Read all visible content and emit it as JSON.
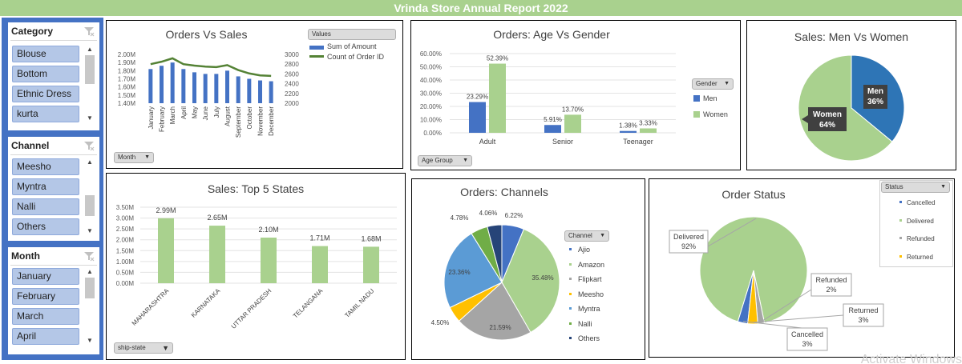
{
  "report_title": "Vrinda Store Annual Report 2022",
  "watermark": "Activate Windows",
  "colors": {
    "green": "#a9d18e",
    "blue": "#4472c4",
    "slicer_item": "#b4c7e7"
  },
  "slicers": {
    "category": {
      "title": "Category",
      "items": [
        "Blouse",
        "Bottom",
        "Ethnic Dress",
        "kurta"
      ]
    },
    "channel": {
      "title": "Channel",
      "items": [
        "Meesho",
        "Myntra",
        "Nalli",
        "Others"
      ]
    },
    "month": {
      "title": "Month",
      "items": [
        "January",
        "February",
        "March",
        "April"
      ]
    }
  },
  "orders_vs_sales": {
    "field_button": "Month",
    "legend_button": "Values",
    "legend": [
      "Sum of Amount",
      "Count of Order ID"
    ],
    "y_left_ticks": [
      "2.00M",
      "1.90M",
      "1.80M",
      "1.70M",
      "1.60M",
      "1.50M",
      "1.40M"
    ],
    "y_right_ticks": [
      "3000",
      "2800",
      "2600",
      "2400",
      "2200",
      "2000"
    ]
  },
  "age_gender": {
    "field_button": "Age Group",
    "legend_button": "Gender",
    "y_ticks": [
      "60.00%",
      "50.00%",
      "40.00%",
      "30.00%",
      "20.00%",
      "10.00%",
      "0.00%"
    ],
    "labels": {
      "adult_men": "23.29%",
      "adult_women": "52.39%",
      "senior_men": "5.91%",
      "senior_women": "13.70%",
      "teen_men": "1.38%",
      "teen_women": "3.33%"
    }
  },
  "men_women": {
    "labels": {
      "men": "Men",
      "men_pct": "36%",
      "women": "Women",
      "women_pct": "64%"
    }
  },
  "top_states": {
    "field_button": "ship-state",
    "y_ticks": [
      "3.50M",
      "3.00M",
      "2.50M",
      "2.00M",
      "1.50M",
      "1.00M",
      "0.50M",
      "0.00M"
    ],
    "value_labels": [
      "2.99M",
      "2.65M",
      "2.10M",
      "1.71M",
      "1.68M"
    ]
  },
  "channels_pie": {
    "legend_button": "Channel",
    "pct_labels": [
      "6.22%",
      "35.48%",
      "21.59%",
      "4.50%",
      "23.36%",
      "4.78%",
      "4.06%"
    ]
  },
  "order_status": {
    "legend_button": "Status",
    "labels": {
      "delivered": "Delivered",
      "delivered_pct": "92%",
      "refunded": "Refunded",
      "refunded_pct": "2%",
      "returned": "Returned",
      "returned_pct": "3%",
      "cancelled": "Cancelled",
      "cancelled_pct": "3%"
    }
  },
  "chart_data": [
    {
      "type": "bar",
      "title": "Orders Vs Sales",
      "categories": [
        "January",
        "February",
        "March",
        "April",
        "May",
        "June",
        "July",
        "August",
        "September",
        "October",
        "November",
        "December"
      ],
      "series": [
        {
          "name": "Sum of Amount",
          "values": [
            1.82,
            1.86,
            1.9,
            1.82,
            1.78,
            1.76,
            1.76,
            1.8,
            1.73,
            1.7,
            1.68,
            1.67
          ],
          "color": "#4472c4"
        },
        {
          "name": "Count of Order ID",
          "values": [
            2800,
            2850,
            2920,
            2800,
            2770,
            2750,
            2740,
            2780,
            2680,
            2610,
            2570,
            2560
          ],
          "color": "#548235",
          "type": "line"
        }
      ],
      "ylim": [
        1.4,
        2.0
      ],
      "y2lim": [
        2000,
        3000
      ],
      "xlabel": "",
      "ylabel": "",
      "legend": "top-right"
    },
    {
      "type": "bar",
      "title": "Orders: Age Vs Gender",
      "categories": [
        "Adult",
        "Senior",
        "Teenager"
      ],
      "series": [
        {
          "name": "Men",
          "values": [
            23.29,
            5.91,
            1.38
          ],
          "color": "#4472c4"
        },
        {
          "name": "Women",
          "values": [
            52.39,
            13.7,
            3.33
          ],
          "color": "#a9d18e"
        }
      ],
      "ylim": [
        0,
        60
      ],
      "legend": "right"
    },
    {
      "type": "pie",
      "title": "Sales: Men Vs Women",
      "categories": [
        "Men",
        "Women"
      ],
      "values": [
        36,
        64
      ],
      "colors": [
        "#2e75b6",
        "#a9d18e"
      ]
    },
    {
      "type": "bar",
      "title": "Sales: Top 5 States",
      "categories": [
        "MAHARASHTRA",
        "KARNATAKA",
        "UTTAR PRADESH",
        "TELANGANA",
        "TAMIL NADU"
      ],
      "values": [
        2.99,
        2.65,
        2.1,
        1.71,
        1.68
      ],
      "ylim": [
        0,
        3.5
      ],
      "color": "#a9d18e"
    },
    {
      "type": "pie",
      "title": "Orders: Channels",
      "categories": [
        "Ajio",
        "Amazon",
        "Flipkart",
        "Meesho",
        "Myntra",
        "Nalli",
        "Others"
      ],
      "values": [
        6.22,
        35.48,
        21.59,
        4.5,
        23.36,
        4.78,
        4.06
      ],
      "colors": [
        "#4472c4",
        "#a9d18e",
        "#a5a5a5",
        "#ffc000",
        "#5b9bd5",
        "#70ad47",
        "#264478"
      ],
      "legend": "right"
    },
    {
      "type": "pie",
      "title": "Order Status",
      "categories": [
        "Cancelled",
        "Delivered",
        "Refunded",
        "Returned"
      ],
      "values": [
        3,
        92,
        2,
        3
      ],
      "colors": [
        "#4472c4",
        "#a9d18e",
        "#a5a5a5",
        "#ffc000"
      ],
      "legend": "right"
    }
  ]
}
